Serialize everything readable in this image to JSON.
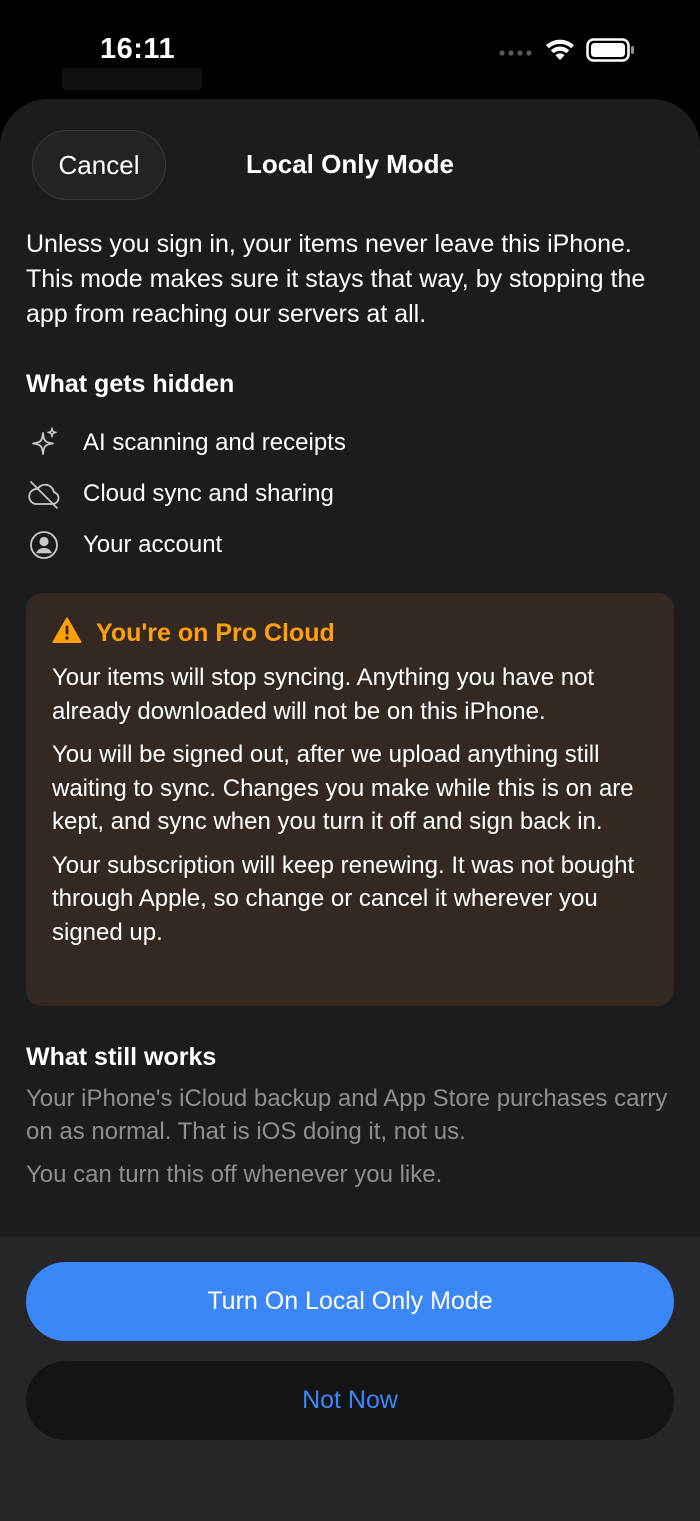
{
  "status_bar": {
    "time": "16:11"
  },
  "sheet": {
    "cancel_label": "Cancel",
    "title": "Local Only Mode"
  },
  "intro_text": "Unless you sign in, your items never leave this iPhone. This mode makes sure it stays that way, by stopping the app from reaching our servers at all.",
  "hidden_section": {
    "heading": "What gets hidden",
    "items": [
      {
        "label": "AI scanning and receipts",
        "icon": "sparkles-icon"
      },
      {
        "label": "Cloud sync and sharing",
        "icon": "cloud-slash-icon"
      },
      {
        "label": "Your account",
        "icon": "person-circle-icon"
      }
    ]
  },
  "warning": {
    "title": "You're on Pro Cloud",
    "icon": "warning-triangle-icon",
    "paragraphs": [
      "Your items will stop syncing. Anything you have not already downloaded will not be on this iPhone.",
      "You will be signed out, after we upload anything still waiting to sync. Changes you make while this is on are kept, and sync when you turn it off and sign back in.",
      "Your subscription will keep renewing. It was not bought through Apple, so change or cancel it wherever you signed up."
    ]
  },
  "works_section": {
    "heading": "What still works",
    "paragraphs": [
      "Your iPhone's iCloud backup and App Store purchases carry on as normal. That is iOS doing it, not us.",
      "You can turn this off whenever you like."
    ]
  },
  "footer": {
    "primary_label": "Turn On Local Only Mode",
    "secondary_label": "Not Now"
  },
  "colors": {
    "accent_blue": "#3b87f7",
    "warning_orange": "#ff9f0a",
    "sheet_bg": "#1c1c1e",
    "warning_bg": "#332922"
  }
}
